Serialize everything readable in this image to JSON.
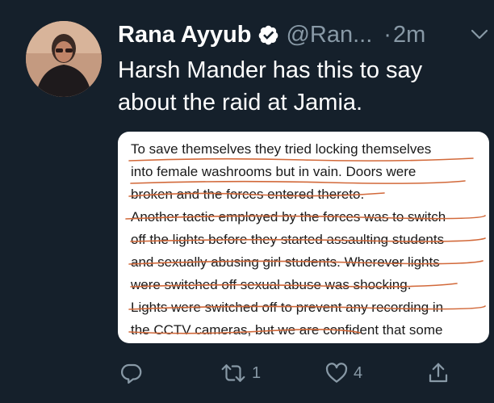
{
  "tweet": {
    "author_name": "Rana Ayyub",
    "handle": "@Ran...",
    "separator": "·",
    "time": "2m",
    "text": "Harsh Mander has this to say about the raid at Jamia."
  },
  "image_text": {
    "lines": [
      "To save themselves they tried locking themselves",
      "into female washrooms but in vain. Doors were",
      "broken and the forces entered thereto.",
      "Another tactic employed by the forces was to switch",
      "off the lights before they started assaulting students",
      "and sexually abusing girl students. Wherever lights",
      "were switched off sexual abuse was shocking.",
      "Lights were switched off to prevent any recording in",
      "the CCTV cameras, but we are confident that some"
    ]
  },
  "actions": {
    "reply_icon": "reply-icon",
    "retweet_icon": "retweet-icon",
    "retweet_count": "1",
    "like_icon": "heart-icon",
    "like_count": "4",
    "share_icon": "share-icon"
  },
  "colors": {
    "background": "#15202b",
    "secondary_text": "#8899a6",
    "verified_badge": "#ffffff",
    "underline": "#d2693a"
  }
}
